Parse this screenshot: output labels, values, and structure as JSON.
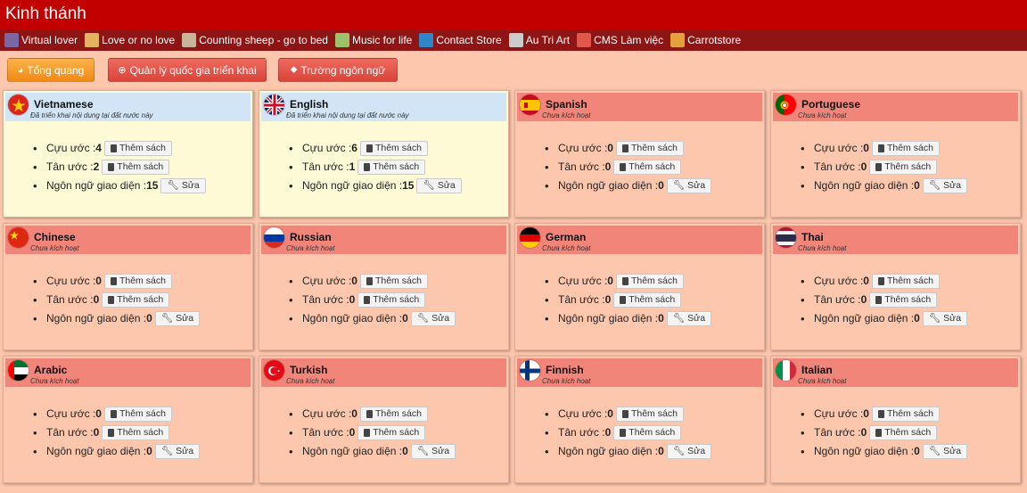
{
  "app": {
    "title": "Kinh thánh"
  },
  "bookmarks": [
    {
      "label": "Virtual lover",
      "icon": "lover-avatar-icon",
      "color": "#7b67a8"
    },
    {
      "label": "Love or no love",
      "icon": "cookie-icon",
      "color": "#e3b35d"
    },
    {
      "label": "Counting sheep - go to bed",
      "icon": "sheep-icon",
      "color": "#c9b59a"
    },
    {
      "label": "Music for life",
      "icon": "landscape-icon",
      "color": "#9cc36a"
    },
    {
      "label": "Contact Store",
      "icon": "contact-icon",
      "color": "#2f86c8"
    },
    {
      "label": "Au Tri Art",
      "icon": "art-icon",
      "color": "#cccccc"
    },
    {
      "label": "CMS Làm việc",
      "icon": "watermelon-icon",
      "color": "#e0584c"
    },
    {
      "label": "Carrotstore",
      "icon": "carrot-icon",
      "color": "#e5a23a"
    }
  ],
  "toolbar": {
    "overview": "Tổng quang",
    "manage_countries": "Quản lý quốc gia triển khai",
    "language_fields": "Trường ngôn ngữ"
  },
  "labels": {
    "old_testament": "Cựu ước :",
    "new_testament": "Tân ước :",
    "ui_language": "Ngôn ngữ giao diện :",
    "add_book": "Thêm sách",
    "edit": "Sửa"
  },
  "languages": [
    {
      "name": "Vietnamese",
      "status": "Đã triển khai nội dung tại đất nước này",
      "active": true,
      "old": "4",
      "new": "2",
      "ui": "15",
      "flag": "vn"
    },
    {
      "name": "English",
      "status": "Đã triển khai nội dung tại đất nước này",
      "active": true,
      "old": "6",
      "new": "1",
      "ui": "15",
      "flag": "gb"
    },
    {
      "name": "Spanish",
      "status": "Chưa kích hoạt",
      "active": false,
      "old": "0",
      "new": "0",
      "ui": "0",
      "flag": "es"
    },
    {
      "name": "Portuguese",
      "status": "Chưa kích hoạt",
      "active": false,
      "old": "0",
      "new": "0",
      "ui": "0",
      "flag": "pt"
    },
    {
      "name": "Chinese",
      "status": "Chưa kích hoạt",
      "active": false,
      "old": "0",
      "new": "0",
      "ui": "0",
      "flag": "cn"
    },
    {
      "name": "Russian",
      "status": "Chưa kích hoạt",
      "active": false,
      "old": "0",
      "new": "0",
      "ui": "0",
      "flag": "ru"
    },
    {
      "name": "German",
      "status": "Chưa kích hoạt",
      "active": false,
      "old": "0",
      "new": "0",
      "ui": "0",
      "flag": "de"
    },
    {
      "name": "Thai",
      "status": "Chưa kích hoạt",
      "active": false,
      "old": "0",
      "new": "0",
      "ui": "0",
      "flag": "th"
    },
    {
      "name": "Arabic",
      "status": "Chưa kích hoạt",
      "active": false,
      "old": "0",
      "new": "0",
      "ui": "0",
      "flag": "ae"
    },
    {
      "name": "Turkish",
      "status": "Chưa kích hoạt",
      "active": false,
      "old": "0",
      "new": "0",
      "ui": "0",
      "flag": "tr"
    },
    {
      "name": "Finnish",
      "status": "Chưa kích hoạt",
      "active": false,
      "old": "0",
      "new": "0",
      "ui": "0",
      "flag": "fi"
    },
    {
      "name": "Italian",
      "status": "Chưa kích hoạt",
      "active": false,
      "old": "0",
      "new": "0",
      "ui": "0",
      "flag": "it"
    }
  ],
  "colors": {
    "title_bar": "#c30000",
    "bookmark_bar": "#8f1414",
    "page_bg": "#fdc7ad",
    "active_card": "#fefad6",
    "active_header": "#d2e5f7",
    "inactive_header": "#f2857a"
  }
}
